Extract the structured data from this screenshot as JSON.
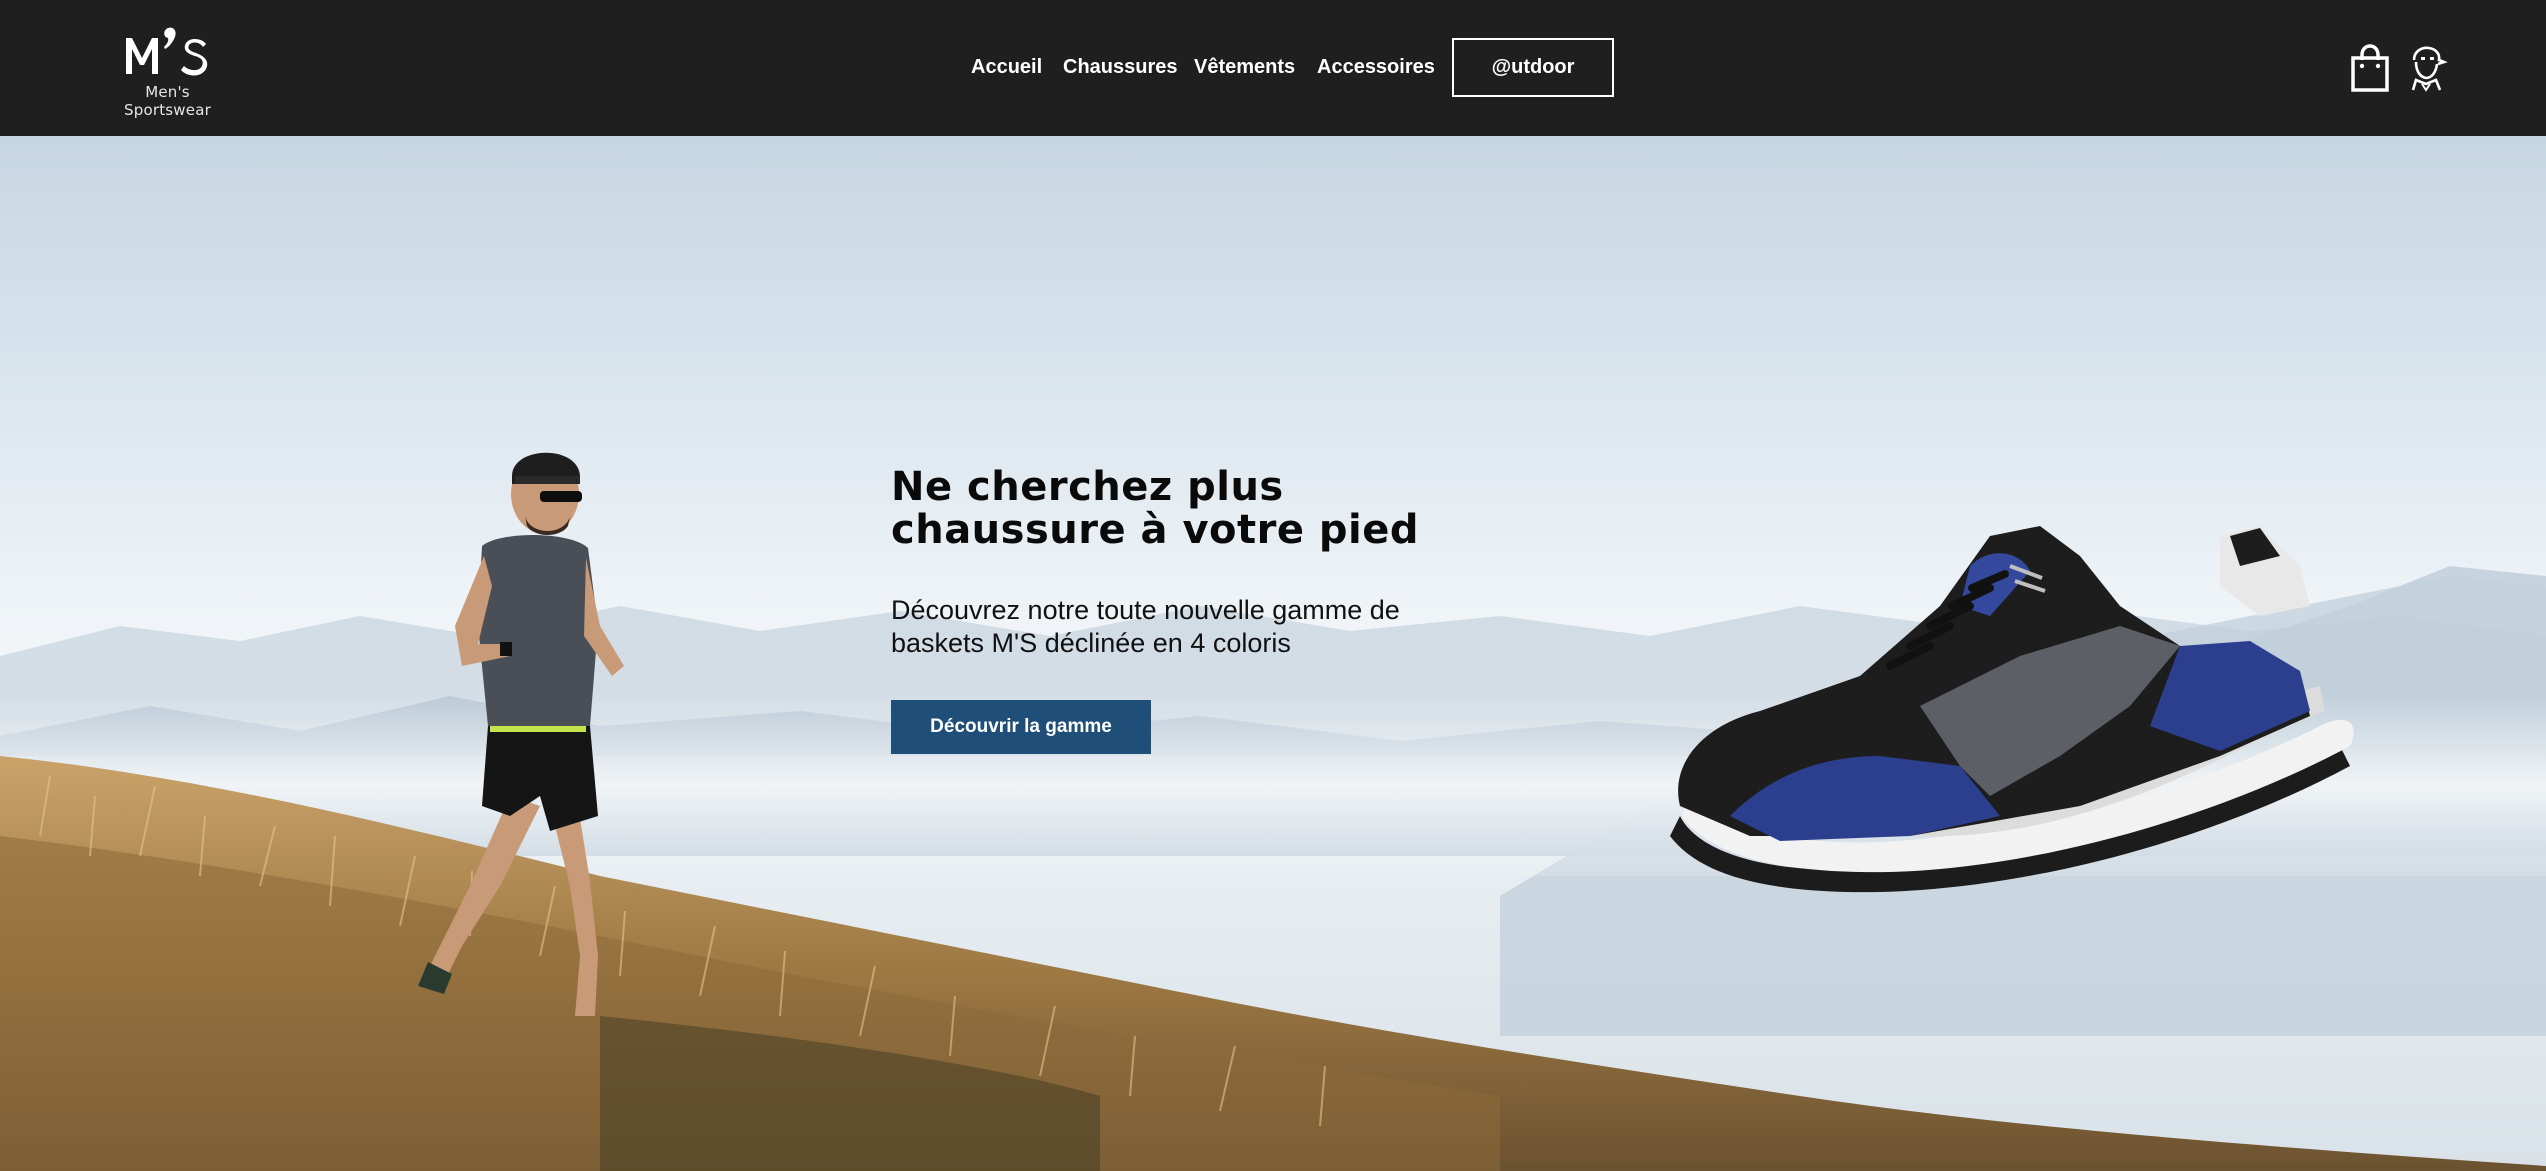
{
  "brand": {
    "logo_mark": "M’S",
    "logo_subtitle": "Men's Sportswear"
  },
  "nav": {
    "items": [
      {
        "label": "Accueil"
      },
      {
        "label": "Chaussures"
      },
      {
        "label": "Vêtements"
      },
      {
        "label": "Accessoires"
      }
    ],
    "outdoor_label": "@utdoor"
  },
  "header_icons": {
    "cart": "shopping-bag-icon",
    "account": "user-account-icon"
  },
  "hero": {
    "title_line1": "Ne cherchez plus",
    "title_line2": "chaussure à votre pied",
    "subtitle_line1": "Découvrez notre toute nouvelle gamme de",
    "subtitle_line2": "baskets M'S déclinée en 4 coloris",
    "cta_label": "Découvrir la gamme"
  },
  "colors": {
    "header_bg": "#1f1f1f",
    "cta_bg": "#1f4e79",
    "sneaker_blue": "#2c3f8f"
  }
}
